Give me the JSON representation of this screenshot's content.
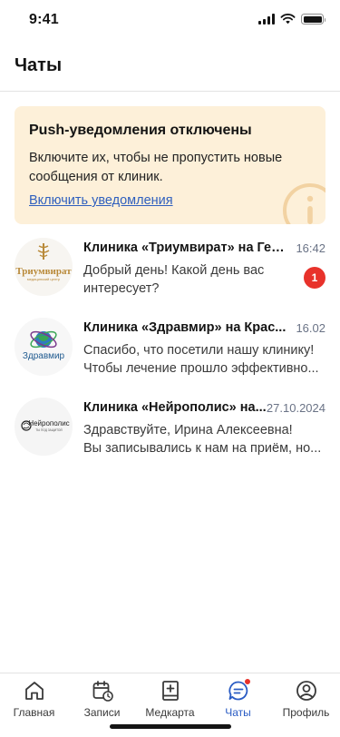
{
  "status_bar": {
    "time": "9:41"
  },
  "header": {
    "title": "Чаты"
  },
  "push_banner": {
    "title": "Push-уведомления отключены",
    "text": "Включите их, чтобы не пропустить новые сообщения от клиник.",
    "link_label": "Включить уведомления",
    "icon": "info-icon"
  },
  "chats": [
    {
      "name": "Клиника «Триумвират» на Гер...",
      "time": "16:42",
      "message_lines": [
        "Добрый день! Какой день вас",
        "интересует?"
      ],
      "unread": "1",
      "logo_text": "Триумвират",
      "logo_subtext": "медицинский центр"
    },
    {
      "name": "Клиника «Здравмир» на Крас...",
      "time": "16.02",
      "message_lines": [
        "Спасибо, что посетили нашу клинику!",
        "Чтобы лечение прошло эффективно..."
      ],
      "logo_text": "Здравмир"
    },
    {
      "name": "Клиника «Нейрополис» на...",
      "time": "27.10.2024",
      "message_lines": [
        "Здравствуйте, Ирина Алексеевна!",
        "Вы записывались к нам на приём, но..."
      ],
      "logo_text": "Нейрополис",
      "logo_subtext": "ТЫ ПОД ЗАЩИТОЙ"
    }
  ],
  "tabbar": {
    "tabs": [
      {
        "label": "Главная",
        "icon": "home-icon"
      },
      {
        "label": "Записи",
        "icon": "calendar-icon"
      },
      {
        "label": "Медкарта",
        "icon": "medical-book-icon"
      },
      {
        "label": "Чаты",
        "icon": "chat-icon",
        "active": true
      },
      {
        "label": "Профиль",
        "icon": "profile-icon"
      }
    ]
  },
  "colors": {
    "accent": "#2a5cc4",
    "banner_bg": "#fdf0d9",
    "badge": "#e8322b",
    "link": "#2f5fbe"
  }
}
